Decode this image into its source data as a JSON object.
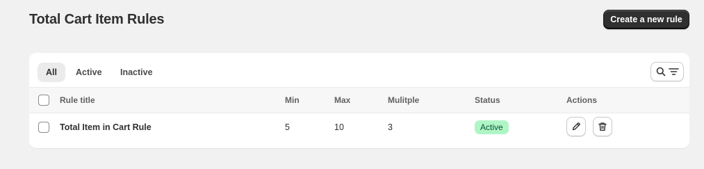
{
  "page": {
    "title": "Total Cart Item Rules",
    "primary_action": "Create a new rule"
  },
  "tabs": [
    {
      "label": "All",
      "selected": true
    },
    {
      "label": "Active",
      "selected": false
    },
    {
      "label": "Inactive",
      "selected": false
    }
  ],
  "toolbar": {
    "search_icon": "search-icon",
    "filter_icon": "filter-icon"
  },
  "table": {
    "columns": [
      "Rule title",
      "Min",
      "Max",
      "Mulitple",
      "Status",
      "Actions"
    ],
    "rows": [
      {
        "title": "Total Item in Cart Rule",
        "min": "5",
        "max": "10",
        "multiple": "3",
        "status": "Active",
        "actions": [
          "edit-icon",
          "delete-icon"
        ]
      }
    ]
  },
  "colors": {
    "background": "#f1f1f1",
    "primary_button": "#303030",
    "status_active_bg": "#aff5c6",
    "status_active_text": "#0c5132"
  }
}
